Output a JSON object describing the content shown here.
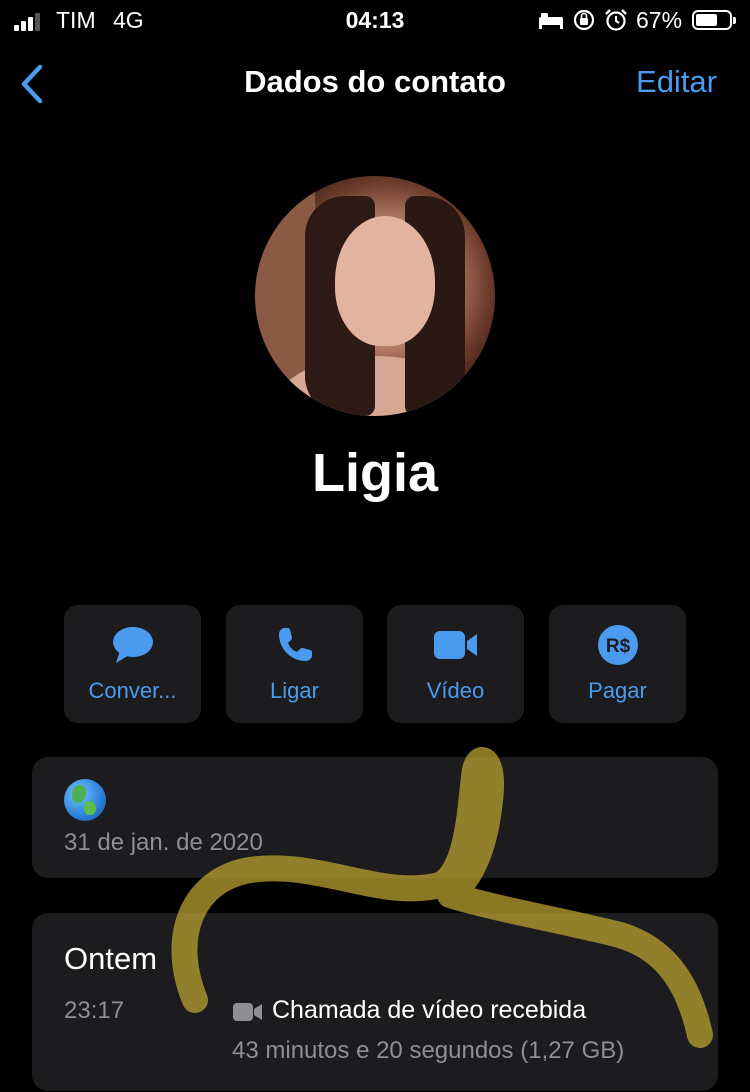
{
  "status_bar": {
    "carrier": "TIM",
    "network": "4G",
    "time": "04:13",
    "battery": "67%",
    "battery_level": 0.67,
    "icons": [
      "bed-icon",
      "rotation-lock-icon",
      "alarm-icon"
    ]
  },
  "nav": {
    "title": "Dados do contato",
    "edit_label": "Editar"
  },
  "contact": {
    "name": "Ligia"
  },
  "actions": [
    {
      "label": "Conver...",
      "icon": "message-bubble-icon"
    },
    {
      "label": "Ligar",
      "icon": "phone-icon"
    },
    {
      "label": "Vídeo",
      "icon": "video-camera-icon"
    },
    {
      "label": "Pagar",
      "icon": "payment-brl-icon"
    }
  ],
  "info": {
    "emoji": "globe-icon",
    "date": "31 de jan. de 2020"
  },
  "calls": {
    "title": "Ontem",
    "time": "23:17",
    "type": "Chamada de vídeo recebida",
    "detail": "43 minutos e 20 segundos (1,27 GB)"
  },
  "colors": {
    "accent": "#4a9bf0",
    "card_bg": "#1c1c1e",
    "secondary_text": "#8e8e93",
    "scribble": "#b8a032"
  }
}
